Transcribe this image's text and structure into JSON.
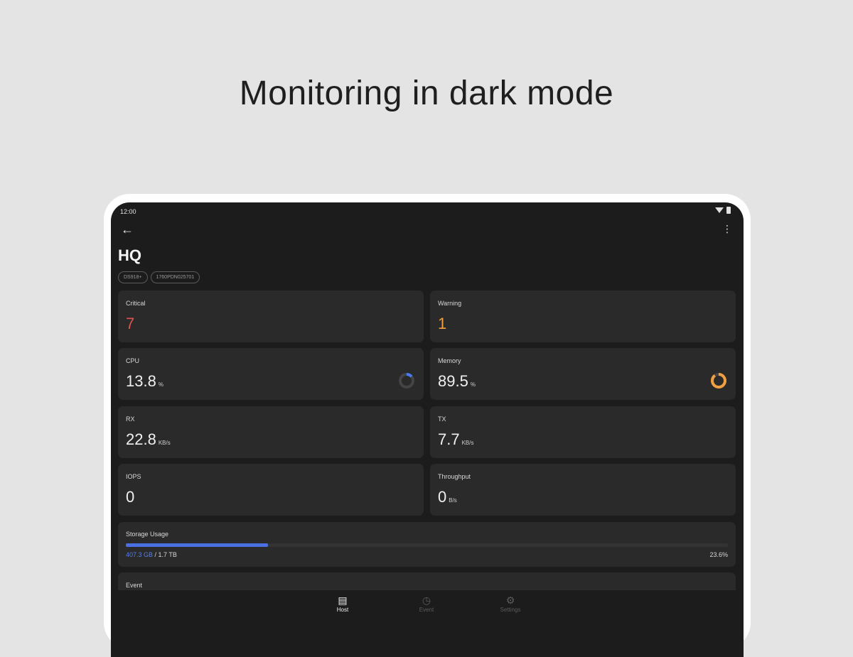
{
  "headline": "Monitoring in dark mode",
  "status_bar": {
    "time": "12:00"
  },
  "header": {
    "title": "HQ",
    "chips": [
      "DS918+",
      "1760PDN025701"
    ]
  },
  "alerts": {
    "critical": {
      "label": "Critical",
      "value": "7"
    },
    "warning": {
      "label": "Warning",
      "value": "1"
    }
  },
  "metrics": {
    "cpu": {
      "label": "CPU",
      "value": "13.8",
      "unit": "%",
      "ring_fraction": 0.138,
      "ring_color": "#4a7bf0"
    },
    "memory": {
      "label": "Memory",
      "value": "89.5",
      "unit": "%",
      "ring_fraction": 0.895,
      "ring_color": "#f0a040"
    },
    "rx": {
      "label": "RX",
      "value": "22.8",
      "unit": "KB/s"
    },
    "tx": {
      "label": "TX",
      "value": "7.7",
      "unit": "KB/s"
    },
    "iops": {
      "label": "IOPS",
      "value": "0"
    },
    "throughput": {
      "label": "Throughput",
      "value": "0",
      "unit": "B/s"
    }
  },
  "storage": {
    "label": "Storage Usage",
    "used": "407.3 GB",
    "separator": " / ",
    "total": "1.7 TB",
    "percent": "23.6%",
    "fraction": 0.236
  },
  "event": {
    "label": "Event"
  },
  "bottom_nav": [
    {
      "label": "Host",
      "icon": "host-icon",
      "active": true
    },
    {
      "label": "Event",
      "icon": "clock-icon",
      "active": false
    },
    {
      "label": "Settings",
      "icon": "gear-icon",
      "active": false
    }
  ]
}
